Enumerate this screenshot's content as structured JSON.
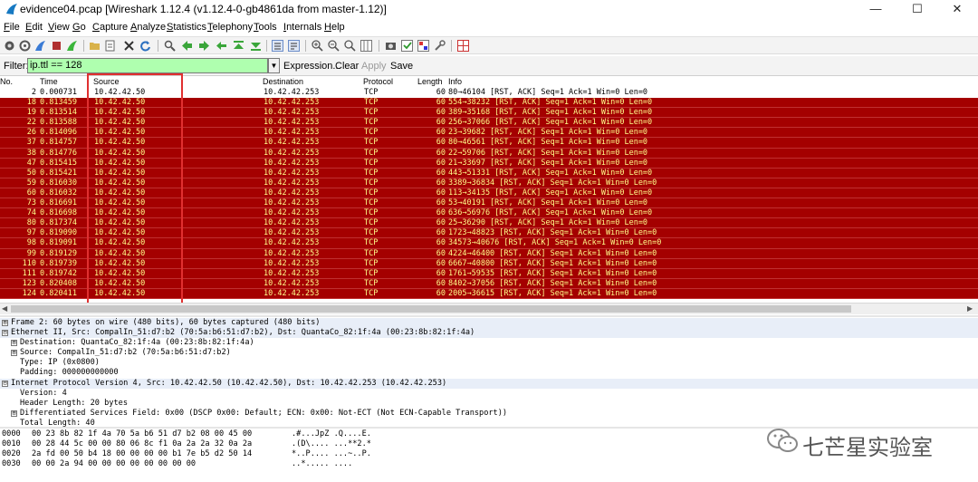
{
  "window": {
    "title": "evidence04.pcap   [Wireshark 1.12.4  (v1.12.4-0-gb4861da from master-1.12)]",
    "minimize": "—",
    "maximize": "☐",
    "close": "✕"
  },
  "menu": [
    "File",
    "Edit",
    "View",
    "Go",
    "Capture",
    "Analyze",
    "Statistics",
    "Telephony",
    "Tools",
    "Internals",
    "Help"
  ],
  "filter": {
    "label": "Filter:",
    "value": "ip.ttl == 128",
    "expression": "Expression...",
    "clear": "Clear",
    "apply": "Apply",
    "save": "Save"
  },
  "columns": {
    "no": "No.",
    "time": "Time",
    "source": "Source",
    "destination": "Destination",
    "protocol": "Protocol",
    "length": "Length",
    "info": "Info"
  },
  "packets": [
    {
      "no": "2",
      "time": "0.000731",
      "src": "10.42.42.50",
      "dst": "10.42.42.253",
      "proto": "TCP",
      "len": "60",
      "info": "80→46104 [RST, ACK] Seq=1 Ack=1 Win=0 Len=0"
    },
    {
      "no": "18",
      "time": "0.813459",
      "src": "10.42.42.50",
      "dst": "10.42.42.253",
      "proto": "TCP",
      "len": "60",
      "info": "554→38232 [RST, ACK] Seq=1 Ack=1 Win=0 Len=0"
    },
    {
      "no": "19",
      "time": "0.813514",
      "src": "10.42.42.50",
      "dst": "10.42.42.253",
      "proto": "TCP",
      "len": "60",
      "info": "389→35168 [RST, ACK] Seq=1 Ack=1 Win=0 Len=0"
    },
    {
      "no": "22",
      "time": "0.813588",
      "src": "10.42.42.50",
      "dst": "10.42.42.253",
      "proto": "TCP",
      "len": "60",
      "info": "256→37066 [RST, ACK] Seq=1 Ack=1 Win=0 Len=0"
    },
    {
      "no": "26",
      "time": "0.814096",
      "src": "10.42.42.50",
      "dst": "10.42.42.253",
      "proto": "TCP",
      "len": "60",
      "info": "23→39682 [RST, ACK] Seq=1 Ack=1 Win=0 Len=0"
    },
    {
      "no": "37",
      "time": "0.814757",
      "src": "10.42.42.50",
      "dst": "10.42.42.253",
      "proto": "TCP",
      "len": "60",
      "info": "80→46561 [RST, ACK] Seq=1 Ack=1 Win=0 Len=0"
    },
    {
      "no": "38",
      "time": "0.814776",
      "src": "10.42.42.50",
      "dst": "10.42.42.253",
      "proto": "TCP",
      "len": "60",
      "info": "22→59706 [RST, ACK] Seq=1 Ack=1 Win=0 Len=0"
    },
    {
      "no": "47",
      "time": "0.815415",
      "src": "10.42.42.50",
      "dst": "10.42.42.253",
      "proto": "TCP",
      "len": "60",
      "info": "21→33697 [RST, ACK] Seq=1 Ack=1 Win=0 Len=0"
    },
    {
      "no": "50",
      "time": "0.815421",
      "src": "10.42.42.50",
      "dst": "10.42.42.253",
      "proto": "TCP",
      "len": "60",
      "info": "443→51331 [RST, ACK] Seq=1 Ack=1 Win=0 Len=0"
    },
    {
      "no": "59",
      "time": "0.816030",
      "src": "10.42.42.50",
      "dst": "10.42.42.253",
      "proto": "TCP",
      "len": "60",
      "info": "3389→36834 [RST, ACK] Seq=1 Ack=1 Win=0 Len=0"
    },
    {
      "no": "60",
      "time": "0.816032",
      "src": "10.42.42.50",
      "dst": "10.42.42.253",
      "proto": "TCP",
      "len": "60",
      "info": "113→34135 [RST, ACK] Seq=1 Ack=1 Win=0 Len=0"
    },
    {
      "no": "73",
      "time": "0.816691",
      "src": "10.42.42.50",
      "dst": "10.42.42.253",
      "proto": "TCP",
      "len": "60",
      "info": "53→40191 [RST, ACK] Seq=1 Ack=1 Win=0 Len=0"
    },
    {
      "no": "74",
      "time": "0.816698",
      "src": "10.42.42.50",
      "dst": "10.42.42.253",
      "proto": "TCP",
      "len": "60",
      "info": "636→56976 [RST, ACK] Seq=1 Ack=1 Win=0 Len=0"
    },
    {
      "no": "80",
      "time": "0.817374",
      "src": "10.42.42.50",
      "dst": "10.42.42.253",
      "proto": "TCP",
      "len": "60",
      "info": "25→36290 [RST, ACK] Seq=1 Ack=1 Win=0 Len=0"
    },
    {
      "no": "97",
      "time": "0.819090",
      "src": "10.42.42.50",
      "dst": "10.42.42.253",
      "proto": "TCP",
      "len": "60",
      "info": "1723→48823 [RST, ACK] Seq=1 Ack=1 Win=0 Len=0"
    },
    {
      "no": "98",
      "time": "0.819091",
      "src": "10.42.42.50",
      "dst": "10.42.42.253",
      "proto": "TCP",
      "len": "60",
      "info": "34573→40676 [RST, ACK] Seq=1 Ack=1 Win=0 Len=0"
    },
    {
      "no": "99",
      "time": "0.819129",
      "src": "10.42.42.50",
      "dst": "10.42.42.253",
      "proto": "TCP",
      "len": "60",
      "info": "4224→46400 [RST, ACK] Seq=1 Ack=1 Win=0 Len=0"
    },
    {
      "no": "110",
      "time": "0.819739",
      "src": "10.42.42.50",
      "dst": "10.42.42.253",
      "proto": "TCP",
      "len": "60",
      "info": "6667→40800 [RST, ACK] Seq=1 Ack=1 Win=0 Len=0"
    },
    {
      "no": "111",
      "time": "0.819742",
      "src": "10.42.42.50",
      "dst": "10.42.42.253",
      "proto": "TCP",
      "len": "60",
      "info": "1761→59535 [RST, ACK] Seq=1 Ack=1 Win=0 Len=0"
    },
    {
      "no": "123",
      "time": "0.820408",
      "src": "10.42.42.50",
      "dst": "10.42.42.253",
      "proto": "TCP",
      "len": "60",
      "info": "8402→37056 [RST, ACK] Seq=1 Ack=1 Win=0 Len=0"
    },
    {
      "no": "124",
      "time": "0.820411",
      "src": "10.42.42.50",
      "dst": "10.42.42.253",
      "proto": "TCP",
      "len": "60",
      "info": "2005→36615 [RST, ACK] Seq=1 Ack=1 Win=0 Len=0"
    }
  ],
  "details": [
    {
      "toggle": "⊞",
      "text": "Frame 2: 60 bytes on wire (480 bits), 60 bytes captured (480 bits)",
      "level": 0
    },
    {
      "toggle": "⊟",
      "text": "Ethernet II, Src: CompalIn_51:d7:b2 (70:5a:b6:51:d7:b2), Dst: QuantaCo_82:1f:4a (00:23:8b:82:1f:4a)",
      "level": 0
    },
    {
      "toggle": "⊞",
      "text": "Destination: QuantaCo_82:1f:4a (00:23:8b:82:1f:4a)",
      "level": 1
    },
    {
      "toggle": "⊞",
      "text": "Source: CompalIn_51:d7:b2 (70:5a:b6:51:d7:b2)",
      "level": 1
    },
    {
      "toggle": "",
      "text": "Type: IP (0x0800)",
      "level": 1
    },
    {
      "toggle": "",
      "text": "Padding: 000000000000",
      "level": 1
    },
    {
      "toggle": "⊟",
      "text": "Internet Protocol Version 4, Src: 10.42.42.50 (10.42.42.50), Dst: 10.42.42.253 (10.42.42.253)",
      "level": 0
    },
    {
      "toggle": "",
      "text": "Version: 4",
      "level": 1
    },
    {
      "toggle": "",
      "text": "Header Length: 20 bytes",
      "level": 1
    },
    {
      "toggle": "⊞",
      "text": "Differentiated Services Field: 0x00 (DSCP 0x00: Default; ECN: 0x00: Not-ECT (Not ECN-Capable Transport))",
      "level": 1
    },
    {
      "toggle": "",
      "text": "Total Length: 40",
      "level": 1
    }
  ],
  "bytes": [
    {
      "off": "0000",
      "hex": "00 23 8b 82 1f 4a 70 5a  b6 51 d7 b2 08 00 45 00",
      "ascii": ".#...JpZ .Q....E."
    },
    {
      "off": "0010",
      "hex": "00 28 44 5c 00 00 80 06  8c f1 0a 2a 2a 32 0a 2a",
      "ascii": ".(D\\.... ...**2.*"
    },
    {
      "off": "0020",
      "hex": "2a fd 00 50 b4 18 00 00  00 00 b1 7e b5 d2 50 14",
      "ascii": "*..P.... ...~..P."
    },
    {
      "off": "0030",
      "hex": "00 00 2a 94 00 00 00 00  00 00 00 00",
      "ascii": "..*..... ...."
    }
  ],
  "watermark": {
    "text": "七芒星实验室"
  }
}
